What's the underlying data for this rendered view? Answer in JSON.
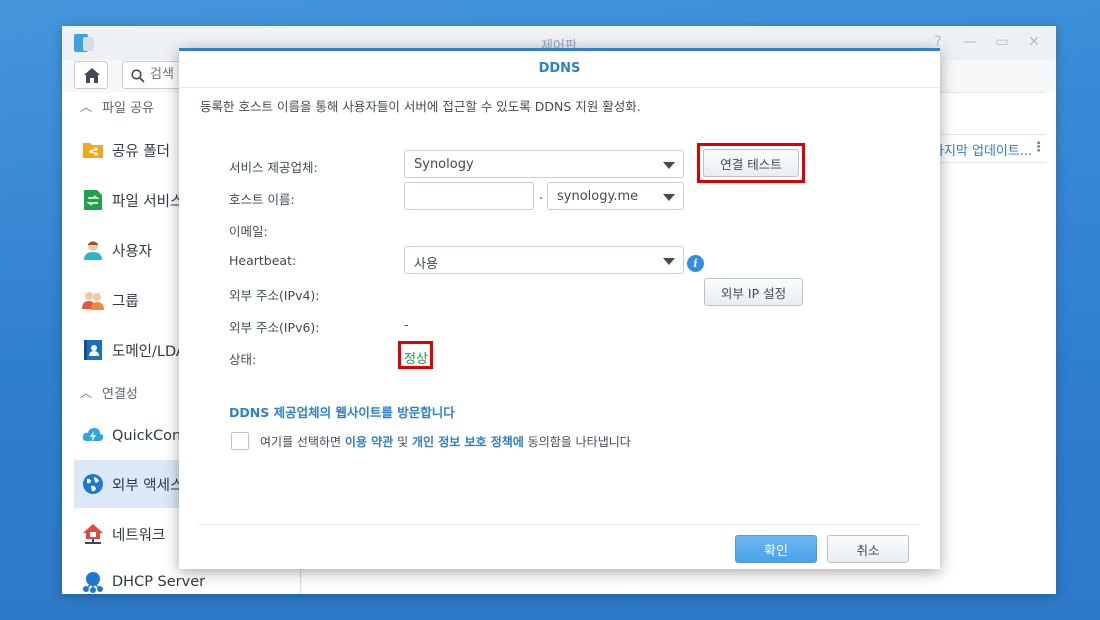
{
  "control_panel": {
    "title": "제어판",
    "search_placeholder": "검색",
    "sidebar": {
      "sections": [
        {
          "label": "파일 공유"
        },
        {
          "label": "연결성"
        }
      ],
      "items": [
        {
          "label": "공유 폴더"
        },
        {
          "label": "파일 서비스"
        },
        {
          "label": "사용자"
        },
        {
          "label": "그룹"
        },
        {
          "label": "도메인/LDAP"
        },
        {
          "label": "QuickConnect"
        },
        {
          "label": "외부 액세스"
        },
        {
          "label": "네트워크"
        },
        {
          "label": "DHCP Server"
        }
      ]
    },
    "main": {
      "column_header": "마지막 업데이트...",
      "kebab": "⋮"
    }
  },
  "dialog": {
    "title": "DDNS",
    "description": "등록한 호스트 이름을 통해 사용자들이 서버에 접근할 수 있도록 DDNS 지원 활성화.",
    "fields": {
      "provider": {
        "label": "서비스 제공업체:",
        "value": "Synology"
      },
      "hostname": {
        "label": "호스트 이름:",
        "value": "",
        "separator": ".",
        "domain": "synology.me"
      },
      "email": {
        "label": "이메일:"
      },
      "heartbeat": {
        "label": "Heartbeat:",
        "value": "사용"
      },
      "ipv4": {
        "label": "외부 주소(IPv4):"
      },
      "ipv6": {
        "label": "외부 주소(IPv6):",
        "value": "-"
      },
      "status": {
        "label": "상태:",
        "value": "정상"
      }
    },
    "buttons": {
      "test_connection": "연결 테스트",
      "external_ip": "외부 IP 설정",
      "ok": "확인",
      "cancel": "취소"
    },
    "provider_link": "DDNS 제공업체의 웹사이트를 방문합니다",
    "agreement": {
      "before": "여기를 선택하면 ",
      "terms": "이용 약관",
      "and": " 및 ",
      "privacy": "개인 정보 보호 정책에",
      "after": " 동의함을 나타냅니다"
    },
    "highlight_color": "#e00000",
    "status_color": "#1b9e3f"
  }
}
